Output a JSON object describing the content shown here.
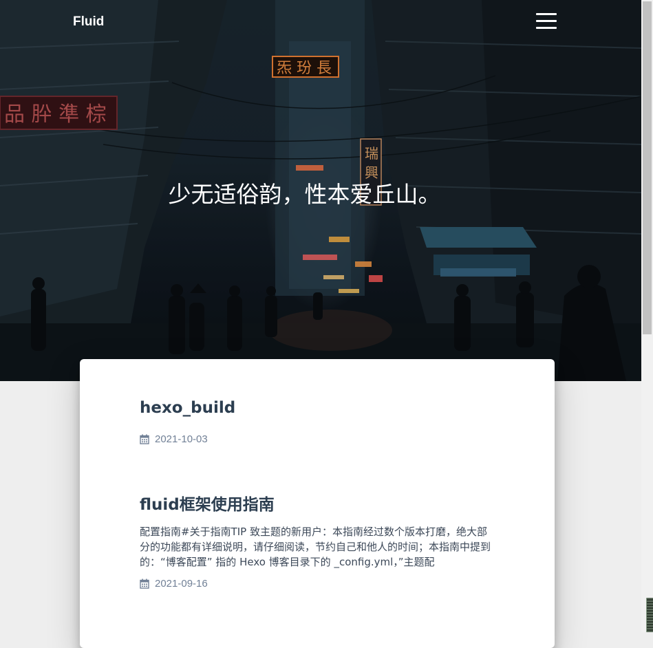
{
  "navbar": {
    "brand": "Fluid",
    "menu_icon": "hamburger-menu-icon"
  },
  "hero": {
    "subtitle": "少无适俗韵，性本爱丘山。",
    "signs": [
      "品 肸 準 棕",
      "炁 玢 長",
      "瑞 興"
    ]
  },
  "posts": [
    {
      "title": "hexo_build",
      "excerpt": "",
      "date": "2021-10-03",
      "date_icon": "calendar-icon"
    },
    {
      "title": "fluid框架使用指南",
      "excerpt": "配置指南#关于指南TIP 致主题的新用户：本指南经过数个版本打磨，绝大部分的功能都有详细说明，请仔细阅读，节约自己和他人的时间；本指南中提到的：“博客配置” 指的 Hexo 博客目录下的 _config.yml，”主题配",
      "date": "2021-09-16",
      "date_icon": "calendar-icon"
    }
  ]
}
